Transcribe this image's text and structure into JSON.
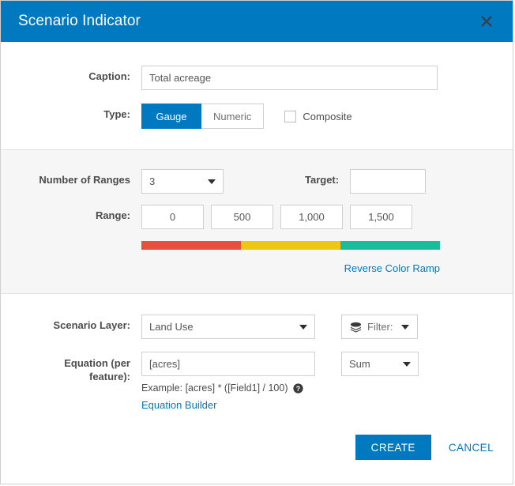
{
  "header": {
    "title": "Scenario Indicator",
    "close_icon": "close-icon"
  },
  "caption": {
    "label": "Caption:",
    "value": "Total acreage",
    "placeholder": ""
  },
  "type": {
    "label": "Type:",
    "options": [
      "Gauge",
      "Numeric"
    ],
    "selected": "Gauge",
    "composite_label": "Composite",
    "composite_checked": false
  },
  "ranges": {
    "number_label": "Number of Ranges",
    "number_value": "3",
    "target_label": "Target:",
    "target_value": "",
    "range_label": "Range:",
    "values": [
      "0",
      "500",
      "1,000",
      "1,500"
    ],
    "ramp_colors": [
      "#e8503e",
      "#efc613",
      "#1abc9c"
    ],
    "reverse_link": "Reverse Color Ramp"
  },
  "layer": {
    "label": "Scenario Layer:",
    "value": "Land Use",
    "filter_label": "Filter:",
    "filter_icon": "layers-icon"
  },
  "equation": {
    "label_line1": "Equation (per",
    "label_line2": "feature):",
    "value": "[acres]",
    "aggregation": "Sum",
    "example": "Example: [acres] * ([Field1] / 100)",
    "help_icon": "help-circle-icon",
    "builder_link": "Equation Builder"
  },
  "footer": {
    "create_label": "CREATE",
    "cancel_label": "CANCEL"
  },
  "colors": {
    "accent": "#0079c1",
    "panel": "#f6f6f6",
    "border": "#cfcfcf"
  }
}
